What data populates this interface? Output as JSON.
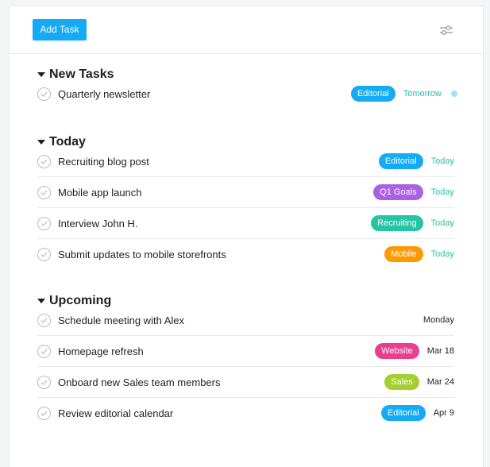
{
  "toolbar": {
    "add_task_label": "Add Task",
    "filter_icon": "sliders-icon"
  },
  "sections": [
    {
      "title": "New Tasks",
      "tasks": [
        {
          "name": "Quarterly newsletter",
          "tag": "Editorial",
          "tag_color": "#14aaf5",
          "due": "Tomorrow",
          "due_color": "green",
          "unread_dot": true
        }
      ]
    },
    {
      "title": "Today",
      "tasks": [
        {
          "name": "Recruiting blog post",
          "tag": "Editorial",
          "tag_color": "#14aaf5",
          "due": "Today",
          "due_color": "green"
        },
        {
          "name": "Mobile app launch",
          "tag": "Q1 Goals",
          "tag_color": "#aa62e3",
          "due": "Today",
          "due_color": "green"
        },
        {
          "name": "Interview John H.",
          "tag": "Recruiting",
          "tag_color": "#25c4a4",
          "due": "Today",
          "due_color": "green"
        },
        {
          "name": "Submit updates to mobile storefronts",
          "tag": "Mobile",
          "tag_color": "#fd9a00",
          "due": "Today",
          "due_color": "green"
        }
      ]
    },
    {
      "title": "Upcoming",
      "tasks": [
        {
          "name": "Schedule meeting with Alex",
          "tag": "",
          "tag_color": "",
          "due": "Monday",
          "due_color": "dark"
        },
        {
          "name": "Homepage refresh",
          "tag": "Website",
          "tag_color": "#e8408f",
          "due": "Mar 18",
          "due_color": "dark"
        },
        {
          "name": "Onboard new Sales team members",
          "tag": "Sales",
          "tag_color": "#a4cf30",
          "due": "Mar 24",
          "due_color": "dark"
        },
        {
          "name": "Review editorial calendar",
          "tag": "Editorial",
          "tag_color": "#14aaf5",
          "due": "Apr 9",
          "due_color": "dark"
        }
      ]
    }
  ]
}
